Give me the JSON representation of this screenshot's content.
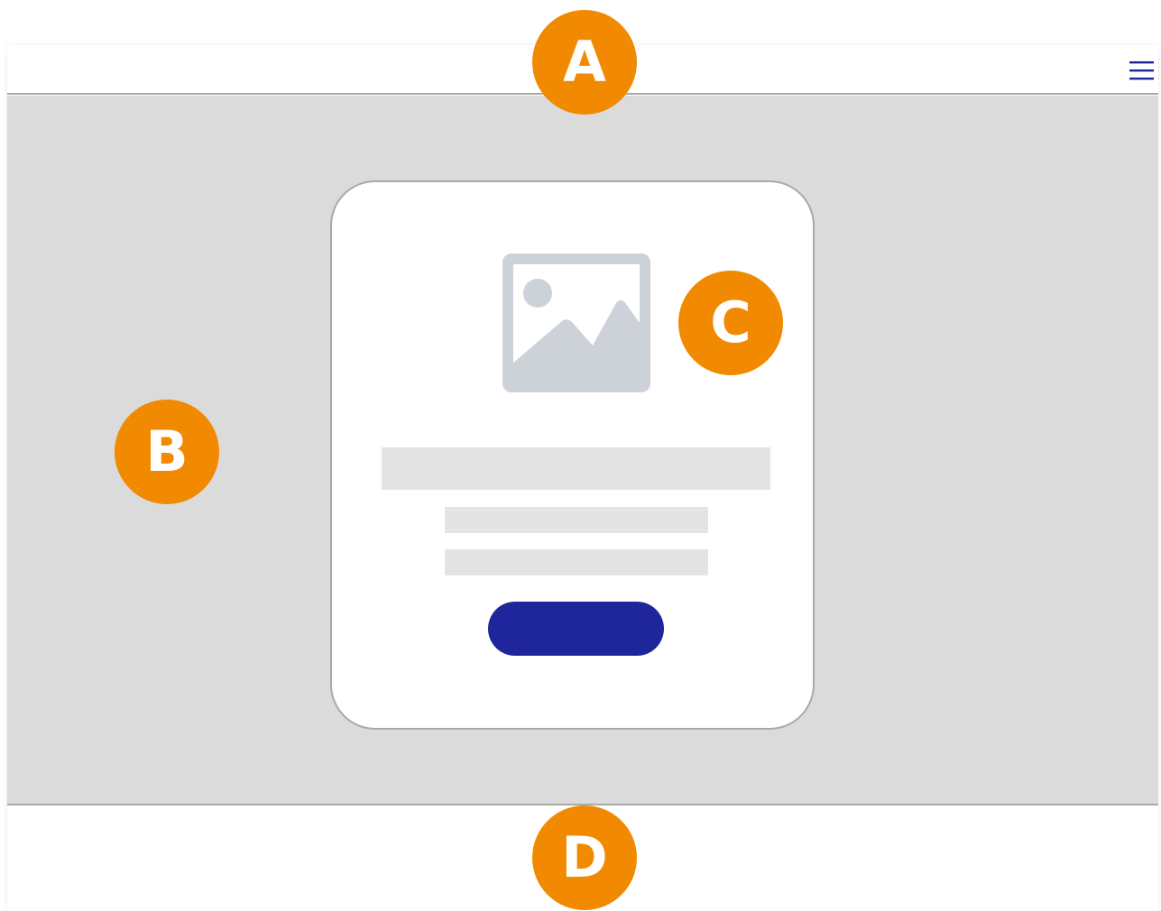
{
  "colors": {
    "badge": "#f18a00",
    "accent": "#1f259b",
    "content_background": "#dbdbdb",
    "placeholder": "#e4e4e4",
    "image_placeholder": "#cdd2d9",
    "border": "#a9a9a9"
  },
  "header": {
    "menu_icon": "hamburger-menu-icon"
  },
  "card": {
    "image_icon": "image-placeholder-icon",
    "button_label": ""
  },
  "badges": {
    "a": "A",
    "b": "B",
    "c": "C",
    "d": "D"
  }
}
